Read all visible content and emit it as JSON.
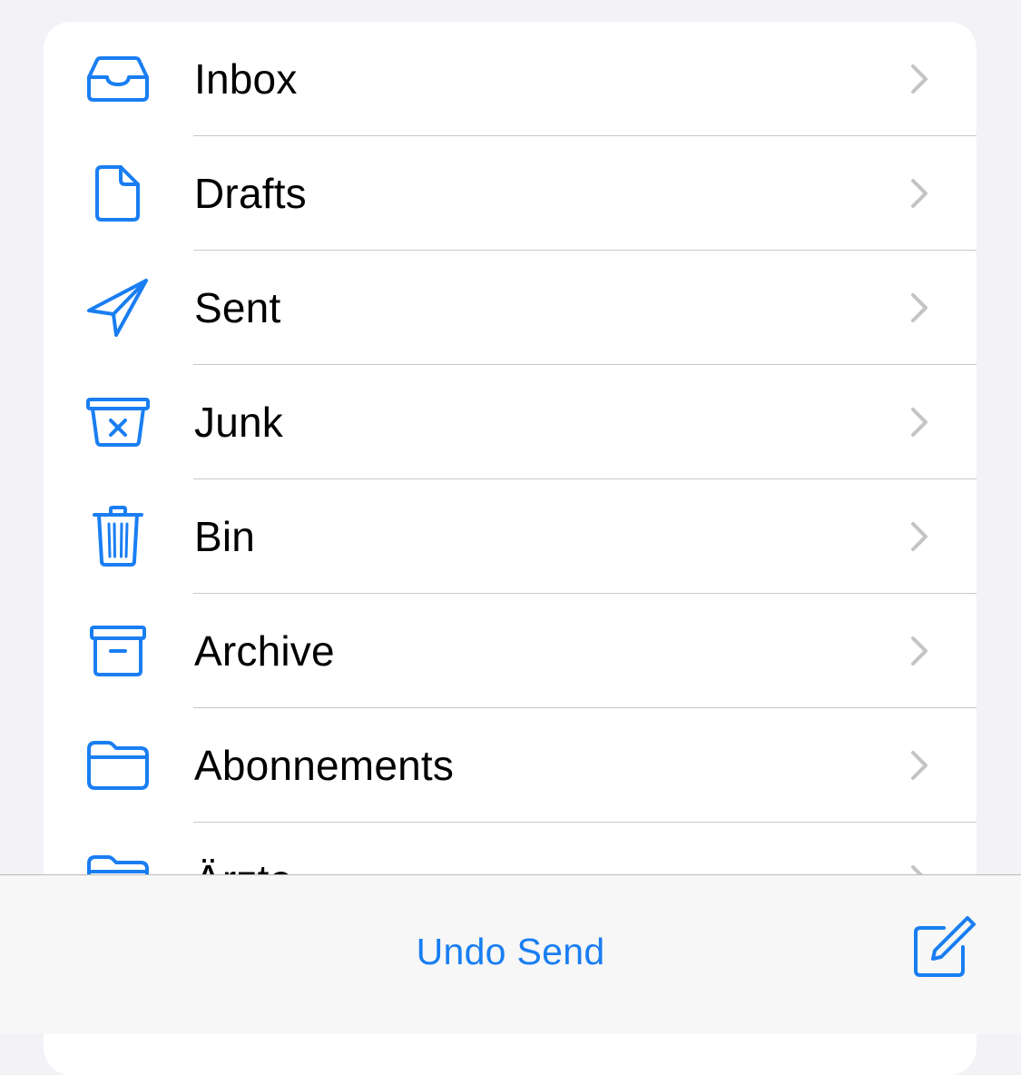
{
  "colors": {
    "accent": "#1a7ef2",
    "chevron": "#c4c4c7",
    "separator": "#c8c8cc",
    "background": "#f2f2f7"
  },
  "folders": [
    {
      "label": "Inbox",
      "icon": "inbox-tray-icon"
    },
    {
      "label": "Drafts",
      "icon": "document-icon"
    },
    {
      "label": "Sent",
      "icon": "paper-plane-icon"
    },
    {
      "label": "Junk",
      "icon": "junk-bin-icon"
    },
    {
      "label": "Bin",
      "icon": "trash-icon"
    },
    {
      "label": "Archive",
      "icon": "archive-box-icon"
    },
    {
      "label": "Abonnements",
      "icon": "folder-icon"
    },
    {
      "label": "Ärzte",
      "icon": "folder-icon"
    }
  ],
  "toolbar": {
    "undo_send_label": "Undo Send",
    "compose_icon": "compose-icon"
  }
}
